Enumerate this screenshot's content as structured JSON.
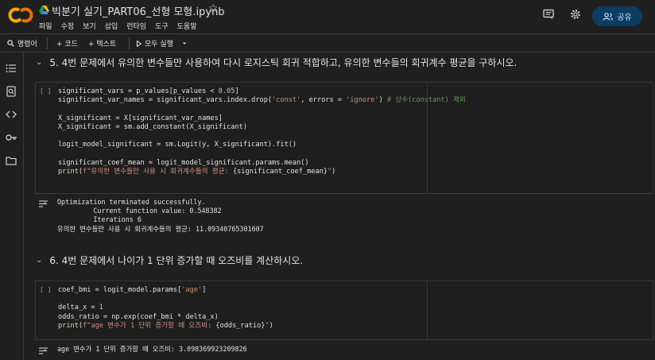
{
  "header": {
    "title": "빅분기 실기_PART06_선형 모형.ipynb",
    "menu": [
      "파일",
      "수정",
      "보기",
      "삽입",
      "런타임",
      "도구",
      "도움말"
    ],
    "share_label": "공유"
  },
  "toolbar": {
    "commands_label": "명령어",
    "code_label": "+ 코드",
    "text_label": "+ 텍스트",
    "run_all_label": "모두 실행"
  },
  "section5": {
    "heading": "5. 4번 문제에서 유의한 변수들만 사용하여 다시 로지스틱 회귀 적합하고, 유의한 변수들의 회귀계수 평균을 구하시오."
  },
  "cell1": {
    "bracket": "[ ]",
    "output_lines": [
      "Optimization terminated successfully.",
      "         Current function value: 0.548382",
      "         Iterations 6",
      "유의한 변수들만 사용 시 회귀계수들의 평균: 11.09340765301607"
    ]
  },
  "section6": {
    "heading": "6. 4번 문제에서 나이가 1 단위 증가할 때 오즈비를 계산하시오."
  },
  "cell2": {
    "bracket": "[ ]",
    "output_lines": [
      "age 변수가 1 단위 증가할 때 오즈비: 3.098369923209826"
    ]
  },
  "colors": {
    "background": "#1f1f1f",
    "share_bg": "#0b3d63",
    "logo_orange": "#f9ab00",
    "logo_dark_orange": "#e37400",
    "string": "#ce9178",
    "number": "#b5cea8",
    "comment": "#6a9955"
  },
  "icons": [
    "colab-logo",
    "drive-icon",
    "star-icon",
    "comment-icon",
    "gear-icon",
    "share-person-icon",
    "search-icon",
    "play-icon",
    "chevron-down-icon",
    "toc-icon",
    "find-icon",
    "code-icon",
    "key-icon",
    "folder-icon",
    "output-icon"
  ]
}
